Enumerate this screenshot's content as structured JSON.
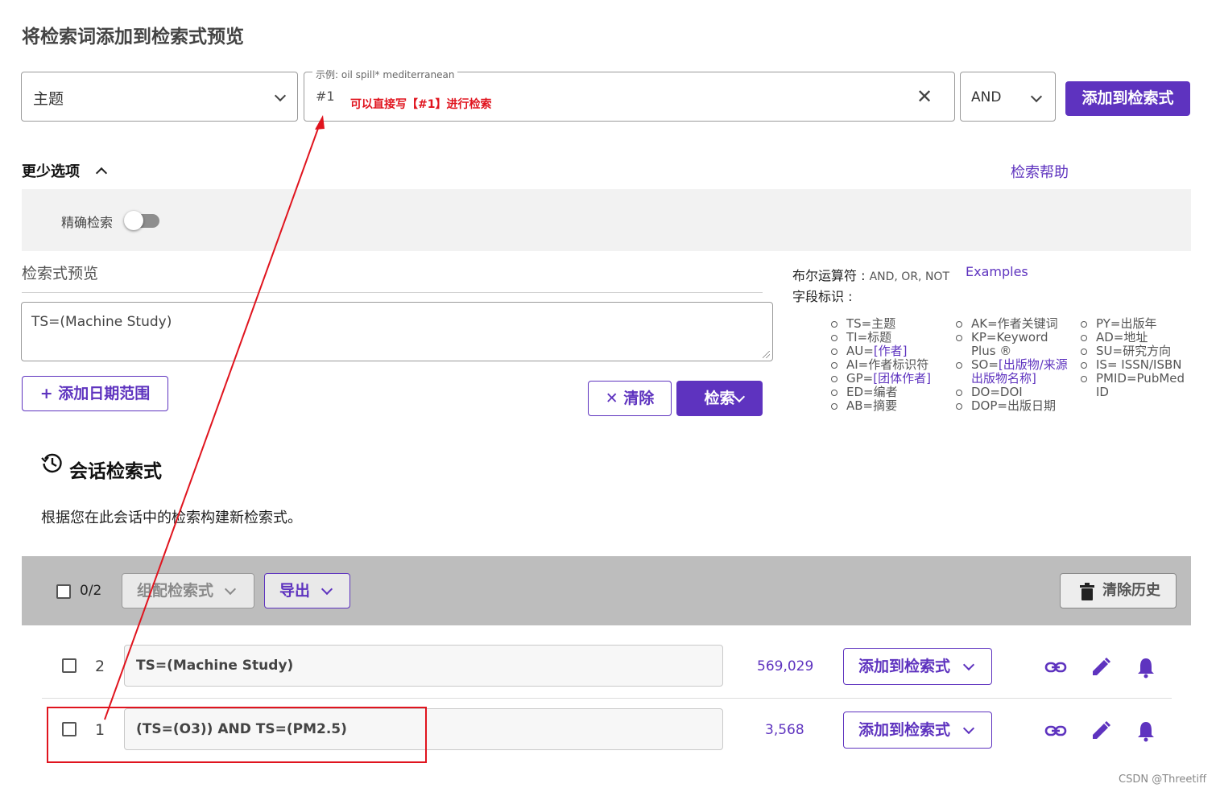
{
  "heading": "将检索词添加到检索式预览",
  "field_select": {
    "value": "主题"
  },
  "query_input": {
    "placeholder": "示例: oil spill* mediterranean",
    "value": "#1"
  },
  "annotation": {
    "note": "可以直接写【#1】进行检索"
  },
  "operator_select": {
    "value": "AND"
  },
  "add_to_query_label": "添加到检索式",
  "fewer_options_label": "更少选项",
  "search_help_label": "检索帮助",
  "exact_search_label": "精确检索",
  "preview": {
    "label": "检索式预览",
    "value": "TS=(Machine Study)"
  },
  "add_date_range_label": "+ 添加日期范围",
  "clear_label": "清除",
  "search_label": "检索",
  "boolean": {
    "label": "布尔运算符 :",
    "value": "AND, OR, NOT",
    "examples_label": "Examples"
  },
  "field_tags": {
    "label": "字段标识 :",
    "col1": [
      {
        "text": "TS=主题"
      },
      {
        "text": "TI=标题"
      },
      {
        "text": "AU=",
        "link": "[作者]"
      },
      {
        "text": "AI=作者标识符"
      },
      {
        "text": "GP=",
        "link": "[团体作者]"
      },
      {
        "text": "ED=编者"
      },
      {
        "text": "AB=摘要"
      }
    ],
    "col2": [
      {
        "text": "AK=作者关键词"
      },
      {
        "text": "KP=Keyword Plus ®"
      },
      {
        "text": "SO=",
        "link": "[出版物/来源出版物名称]"
      },
      {
        "text": "DO=DOI"
      },
      {
        "text": "DOP=出版日期"
      }
    ],
    "col3": [
      {
        "text": "PY=出版年"
      },
      {
        "text": "AD=地址"
      },
      {
        "text": "SU=研究方向"
      },
      {
        "text": "IS= ISSN/ISBN"
      },
      {
        "text": "PMID=PubMed ID"
      }
    ]
  },
  "history": {
    "title": "会话检索式",
    "description": "根据您在此会话中的检索构建新检索式。",
    "select_count": "0/2",
    "combine_label": "组配检索式",
    "export_label": "导出",
    "clear_history_label": "清除历史",
    "rows": [
      {
        "num": "2",
        "query": "TS=(Machine Study)",
        "count": "569,029",
        "add_label": "添加到检索式"
      },
      {
        "num": "1",
        "query": "(TS=(O3)) AND TS=(PM2.5)",
        "count": "3,568",
        "add_label": "添加到检索式"
      }
    ]
  },
  "watermark": "CSDN @Threetiff",
  "colors": {
    "accent": "#5e33bf",
    "annotation": "#e0141e",
    "toolbar": "#bdbdbd",
    "panel": "#f2f2f2"
  }
}
